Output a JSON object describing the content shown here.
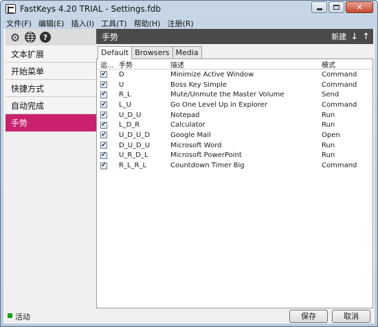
{
  "window": {
    "title": "FastKeys 4.20 TRIAL - Settings.fdb"
  },
  "menu": [
    "文件(F)",
    "编辑(E)",
    "插入(I)",
    "工具(T)",
    "帮助(H)",
    "注册(R)"
  ],
  "sidebar": {
    "icons": [
      "gear-icon",
      "globe-icon",
      "help-icon"
    ],
    "items": [
      {
        "label": "文本扩展"
      },
      {
        "label": "开始菜单"
      },
      {
        "label": "快捷方式"
      },
      {
        "label": "自动完成"
      },
      {
        "label": "手势",
        "active": true
      }
    ],
    "active_color": "#c9216e"
  },
  "panel": {
    "title": "手势",
    "new_label": "新建",
    "down_arrow": "↓",
    "up_arrow": "↑"
  },
  "tabs": [
    "Default",
    "Browsers",
    "Media"
  ],
  "table": {
    "headers": [
      "运...",
      "手势",
      "描述",
      "模式"
    ],
    "rows": [
      {
        "checked": true,
        "gesture": "D",
        "description": "Minimize Active Window",
        "mode": "Command"
      },
      {
        "checked": true,
        "gesture": "U",
        "description": "Boss Key Simple",
        "mode": "Command"
      },
      {
        "checked": true,
        "gesture": "R_L",
        "description": "Mute/Unmute the Master Volume",
        "mode": "Send"
      },
      {
        "checked": true,
        "gesture": "L_U",
        "description": "Go One Level Up in Explorer",
        "mode": "Command"
      },
      {
        "checked": true,
        "gesture": "U_D_U",
        "description": "Notepad",
        "mode": "Run"
      },
      {
        "checked": true,
        "gesture": "L_D_R",
        "description": "Calculator",
        "mode": "Run"
      },
      {
        "checked": true,
        "gesture": "U_D_U_D",
        "description": "Google Mail",
        "mode": "Open"
      },
      {
        "checked": true,
        "gesture": "D_U_D_U",
        "description": "Microsoft Word",
        "mode": "Run"
      },
      {
        "checked": true,
        "gesture": "U_R_D_L",
        "description": "Microsoft PowerPoint",
        "mode": "Run"
      },
      {
        "checked": true,
        "gesture": "R_L_R_L",
        "description": "Countdown Timer Big",
        "mode": "Command"
      }
    ]
  },
  "status": {
    "text": "活动",
    "color": "#17a317"
  },
  "buttons": {
    "save": "保存",
    "cancel": "取消"
  }
}
